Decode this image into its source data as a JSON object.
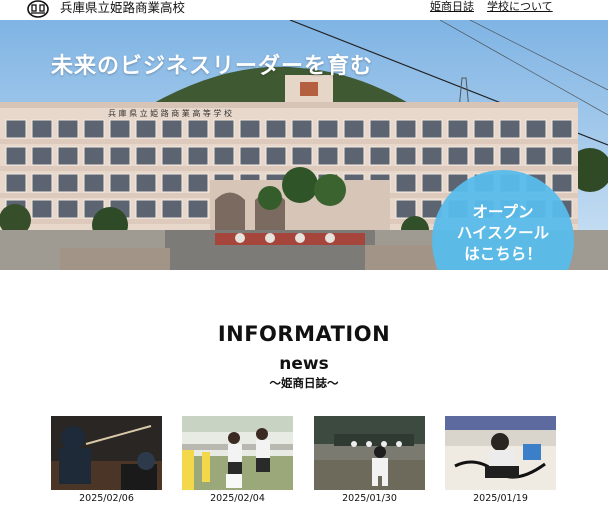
{
  "header": {
    "school_name": "兵庫県立姫路商業高校",
    "nav": [
      {
        "label": "姫商日誌"
      },
      {
        "label": "学校について"
      }
    ]
  },
  "hero": {
    "title": "未来のビジネスリーダーを育む",
    "building_sign": "兵 庫 県 立 姫 路 商 業 高 等 学 校",
    "cta_lines": [
      "オープン",
      "ハイスクール",
      "はこちら！"
    ],
    "cta_color": "#58bceb"
  },
  "info": {
    "heading": "INFORMATION",
    "news_heading": "news",
    "news_sub": "〜姫商日誌〜"
  },
  "news_items": [
    {
      "date": "2025/02/06",
      "image": "kendo-practice-photo"
    },
    {
      "date": "2025/02/04",
      "image": "students-cleaning-photo"
    },
    {
      "date": "2025/01/30",
      "image": "baseball-practice-photo"
    },
    {
      "date": "2025/01/19",
      "image": "calligraphy-photo"
    }
  ]
}
